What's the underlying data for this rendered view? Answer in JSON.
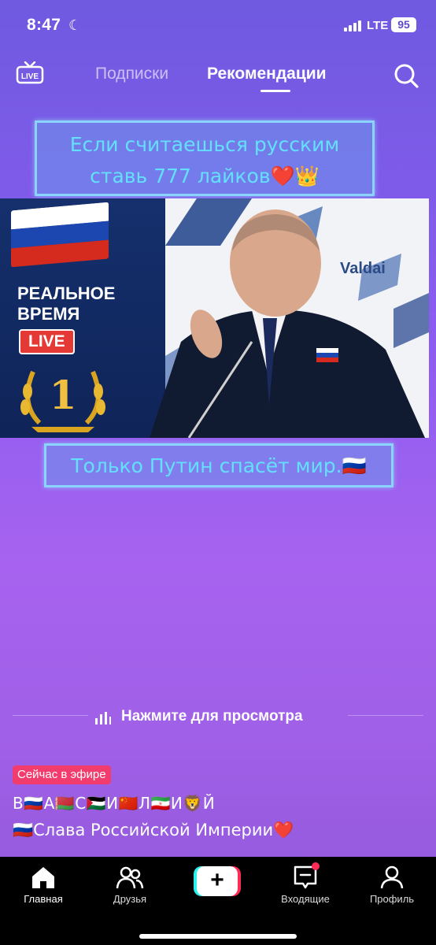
{
  "status_bar": {
    "time": "8:47",
    "network": "LTE",
    "battery": "95",
    "icons": [
      "moon-icon",
      "signal-icon"
    ]
  },
  "top_nav": {
    "live_label": "LIVE",
    "tabs": [
      {
        "label": "Подписки",
        "active": false
      },
      {
        "label": "Рекомендации",
        "active": true
      }
    ]
  },
  "video": {
    "caption_top": [
      "Если считаешься русским",
      "ставь 777 лайков❤️👑"
    ],
    "caption_bottom": "Только Путин спасёт мир.🇷🇺",
    "overlay_title_1": "РЕАЛЬНОЕ",
    "overlay_title_2": "ВРЕМЯ",
    "overlay_badge": "LIVE",
    "rank_number": "1",
    "backdrop_text": "Valdai"
  },
  "cta": {
    "label": "Нажмите для просмотра",
    "icon": "audio-bars-icon"
  },
  "live_badge": "Сейчас в эфире",
  "username": "В🇷🇺А🇧🇾С🇵🇸И🇨🇳Л🇮🇷И🦁Й",
  "description": "🇷🇺Слава Российской Империи❤️",
  "bottom_nav": [
    {
      "label": "Главная",
      "icon": "home-icon",
      "active": true
    },
    {
      "label": "Друзья",
      "icon": "friends-icon",
      "active": false
    },
    {
      "label": "",
      "icon": "plus-icon",
      "active": false
    },
    {
      "label": "Входящие",
      "icon": "inbox-icon",
      "active": false,
      "badge": true
    },
    {
      "label": "Профиль",
      "icon": "profile-icon",
      "active": false
    }
  ],
  "colors": {
    "accent_pink": "#fe2c55",
    "accent_cyan": "#25f4ee",
    "on_air": "#f23c6e"
  }
}
